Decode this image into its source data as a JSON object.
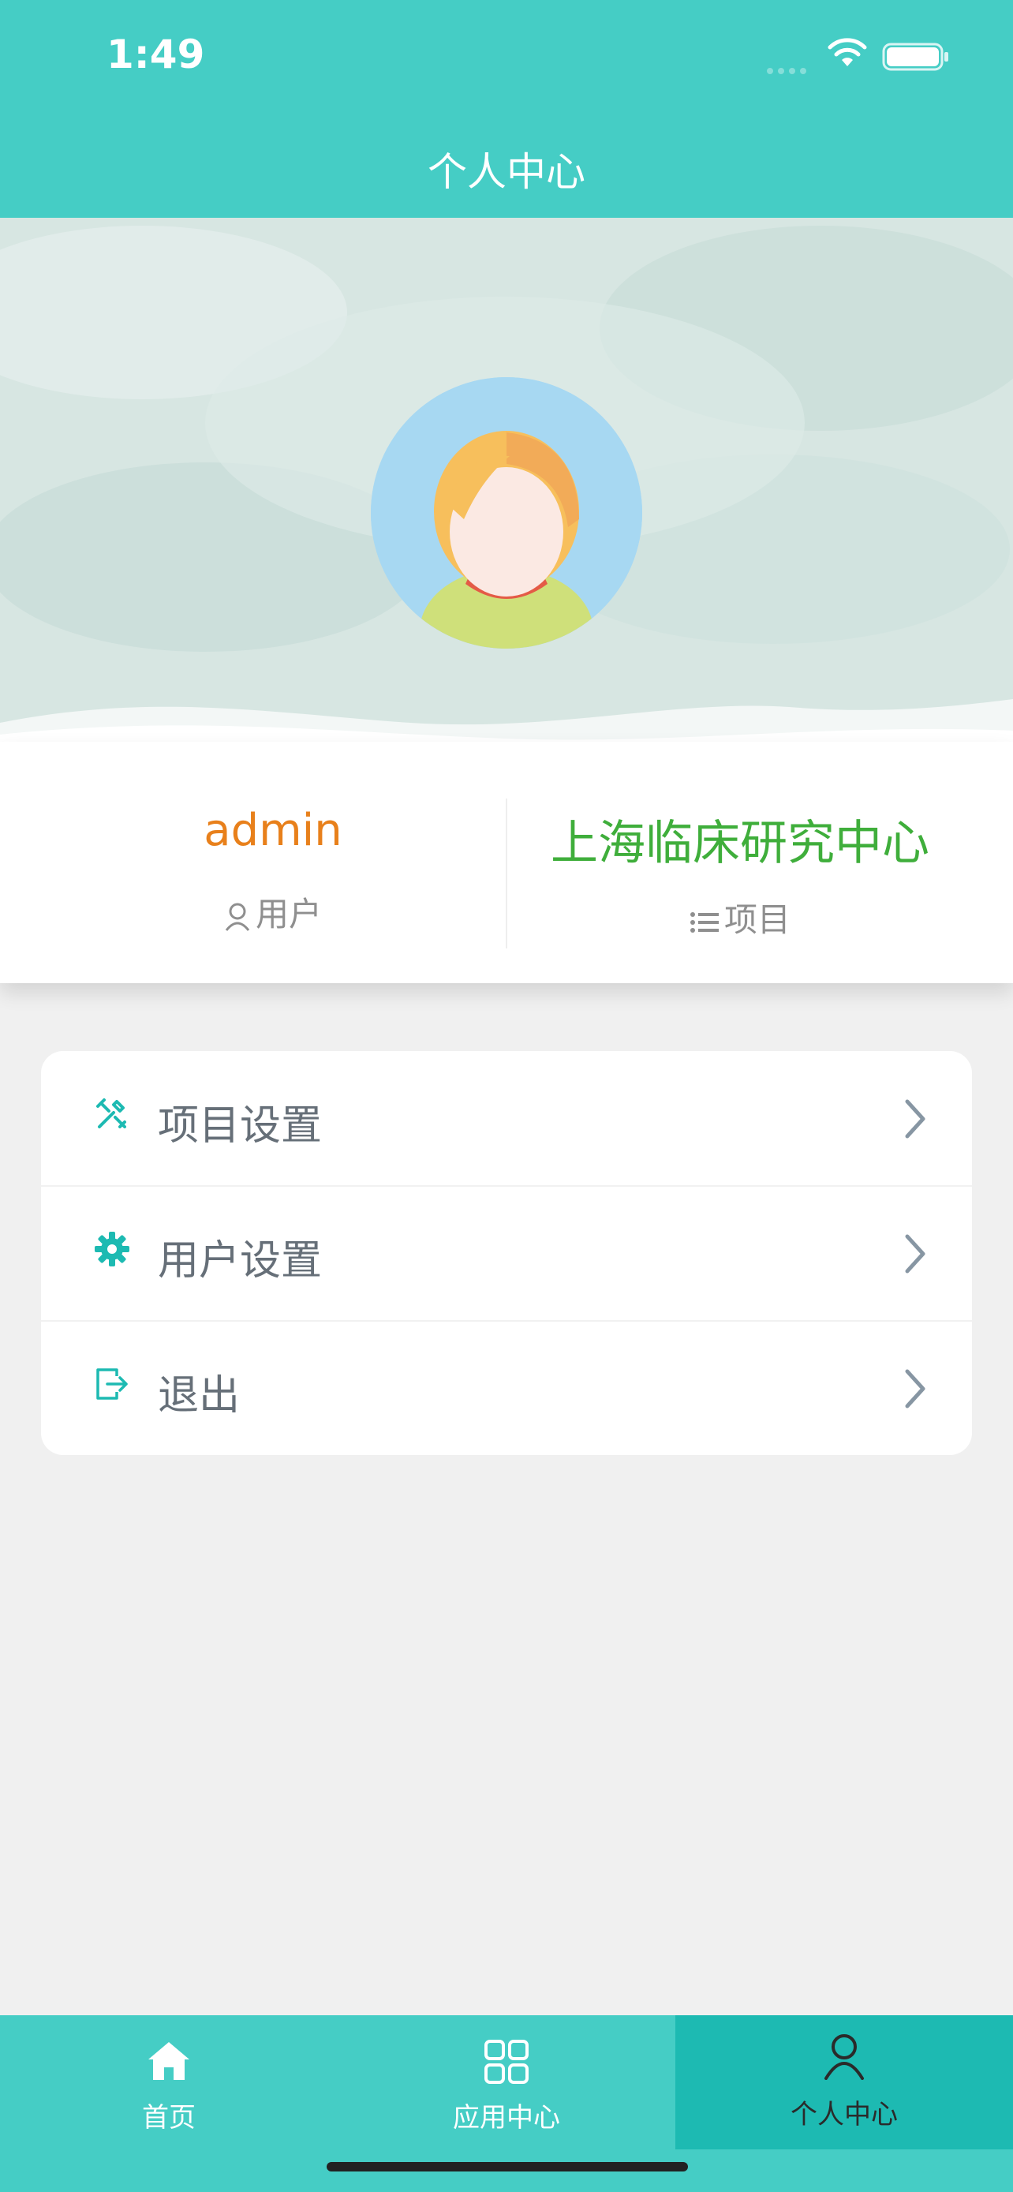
{
  "status_bar": {
    "time": "1:49"
  },
  "header": {
    "title": "个人中心"
  },
  "profile": {
    "username": "admin",
    "user_label": "用户",
    "project_name": "上海临床研究中心",
    "project_label": "项目"
  },
  "menu": {
    "items": [
      {
        "label": "项目设置",
        "icon": "tools-icon"
      },
      {
        "label": "用户设置",
        "icon": "gear-icon"
      },
      {
        "label": "退出",
        "icon": "logout-icon"
      }
    ]
  },
  "tabs": [
    {
      "label": "首页",
      "icon": "home-icon",
      "active": false
    },
    {
      "label": "应用中心",
      "icon": "grid-icon",
      "active": false
    },
    {
      "label": "个人中心",
      "icon": "person-icon",
      "active": true
    }
  ],
  "colors": {
    "primary": "#45cdc5",
    "active_tab": "#1dbab2",
    "username": "#e8801b",
    "project": "#3fae3b"
  }
}
